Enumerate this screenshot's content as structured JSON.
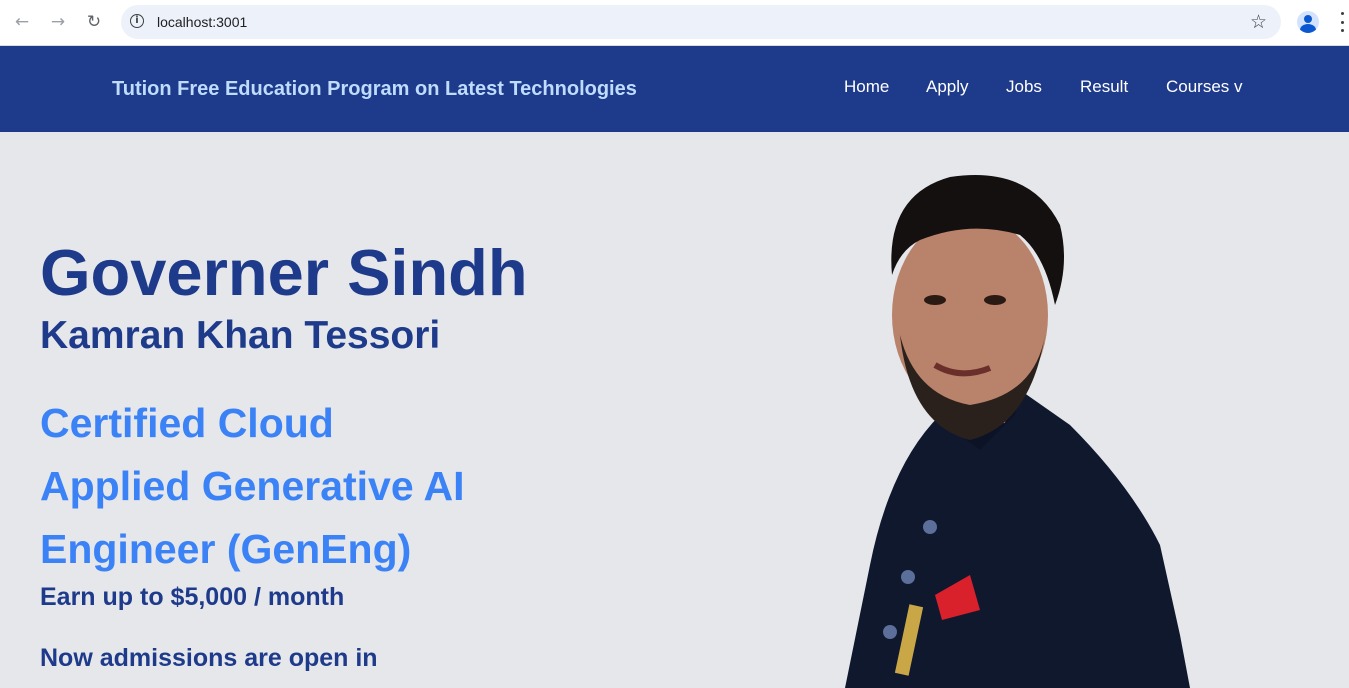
{
  "browser": {
    "url": "localhost:3001"
  },
  "header": {
    "brand": "Tution Free Education Program on Latest Technologies",
    "menu": [
      "Home",
      "Apply",
      "Jobs",
      "Result",
      "Courses v"
    ]
  },
  "hero": {
    "title": "Governer Sindh",
    "subtitle": "Kamran Khan Tessori",
    "programs": [
      "Certified Cloud",
      "Applied Generative AI",
      "Engineer (GenEng)"
    ],
    "earn": "Earn up to $5,000 / month",
    "admissions": "Now admissions are open in"
  },
  "colors": {
    "header_bg": "#1e3a8a",
    "page_bg": "#e5e7eb",
    "brand_text": "#bfdbfe",
    "heading": "#1e3a8a",
    "program_text": "#3b82f6"
  },
  "icons": {
    "back": "arrow-left-icon",
    "forward": "arrow-right-icon",
    "reload": "reload-icon",
    "site_info": "info-icon",
    "bookmark": "star-icon",
    "profile": "profile-icon",
    "menu": "kebab-menu-icon"
  }
}
